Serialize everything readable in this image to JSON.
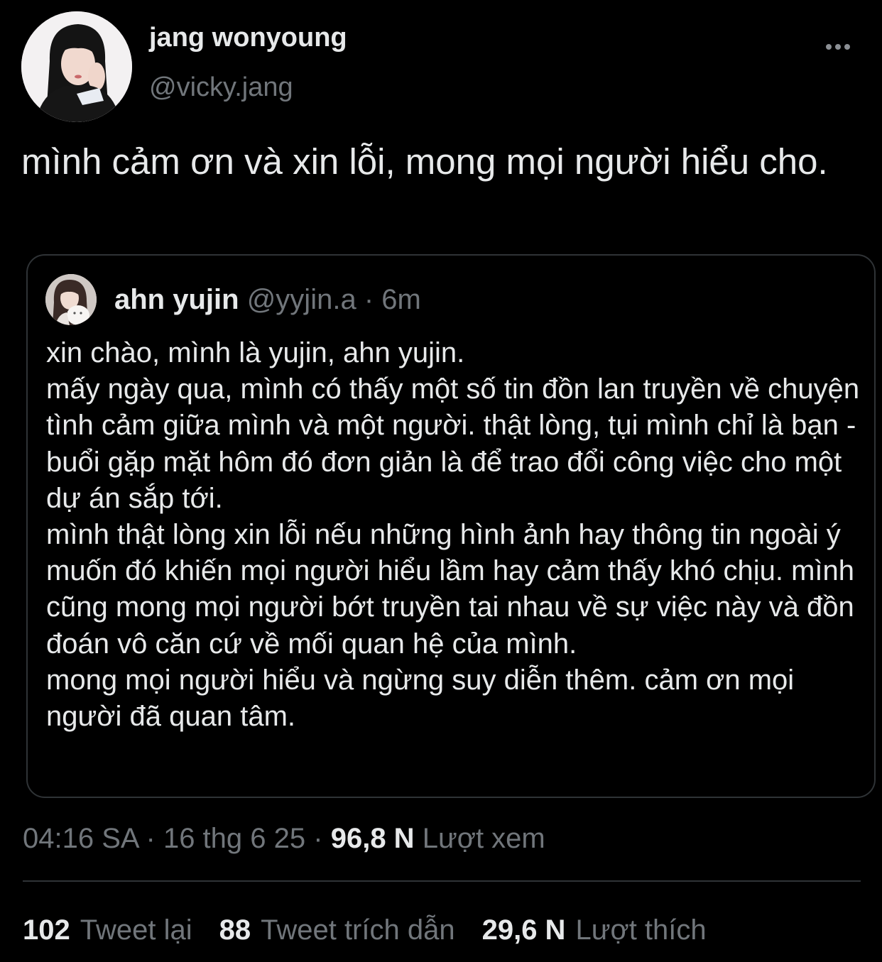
{
  "author": {
    "display_name": "jang wonyoung",
    "handle": "@vicky.jang"
  },
  "tweet": {
    "text": "mình cảm ơn và xin lỗi, mong mọi người hiểu cho."
  },
  "quoted_tweet": {
    "display_name": "ahn yujin",
    "handle": "@yyjin.a",
    "separator": "·",
    "time": "6m",
    "text": "xin chào, mình là yujin, ahn yujin.\nmấy ngày qua, mình có thấy một số tin đồn lan truyền về chuyện tình cảm giữa mình và một người. thật lòng, tụi mình chỉ là bạn - buổi gặp mặt hôm đó đơn giản là để trao đổi công việc cho một dự án sắp tới.\nmình thật lòng xin lỗi nếu những hình ảnh hay thông tin ngoài ý muốn đó khiến mọi người hiểu lầm hay cảm thấy khó chịu. mình cũng mong mọi người bớt truyền tai nhau về sự việc này và đồn đoán vô căn cứ về mối quan hệ của mình.\nmong mọi người hiểu và ngừng suy diễn thêm. cảm ơn mọi người đã quan tâm."
  },
  "meta": {
    "time": "04:16 SA",
    "separator": "·",
    "date": "16 thg 6 25",
    "views_count": "96,8 N",
    "views_label": "Lượt xem"
  },
  "stats": {
    "retweets_count": "102",
    "retweets_label": "Tweet lại",
    "quotes_count": "88",
    "quotes_label": "Tweet trích dẫn",
    "likes_count": "29,6 N",
    "likes_label": "Lượt thích"
  },
  "icons": {
    "more": "more-horizontal-icon"
  },
  "colors": {
    "background": "#000000",
    "primary_text": "#e7e9ea",
    "secondary_text": "#71767b",
    "border": "#2f3336"
  }
}
